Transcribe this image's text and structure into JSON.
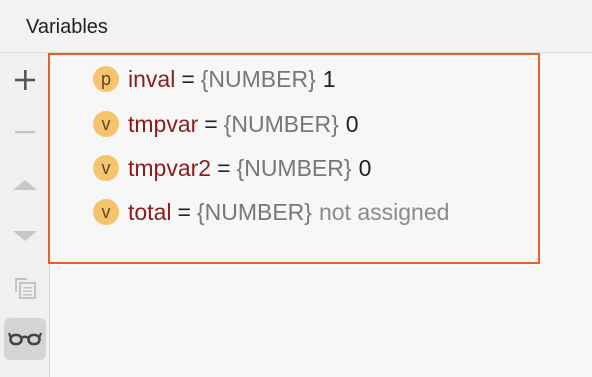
{
  "header": {
    "title": "Variables"
  },
  "toolbar": {
    "buttons": [
      {
        "name": "add",
        "icon": "plus-icon",
        "enabled": true
      },
      {
        "name": "remove",
        "icon": "minus-icon",
        "enabled": false
      },
      {
        "name": "move-up",
        "icon": "arrow-up-icon",
        "enabled": false
      },
      {
        "name": "move-down",
        "icon": "arrow-down-icon",
        "enabled": false
      },
      {
        "name": "copy",
        "icon": "copy-icon",
        "enabled": false
      },
      {
        "name": "watches",
        "icon": "glasses-icon",
        "enabled": true,
        "active": true
      }
    ]
  },
  "variables": [
    {
      "badge": "p",
      "name": "inval",
      "eq": "=",
      "type": "{NUMBER}",
      "value": "1",
      "value_muted": false
    },
    {
      "badge": "v",
      "name": "tmpvar",
      "eq": "=",
      "type": "{NUMBER}",
      "value": "0",
      "value_muted": false
    },
    {
      "badge": "v",
      "name": "tmpvar2",
      "eq": "=",
      "type": "{NUMBER}",
      "value": "0",
      "value_muted": false
    },
    {
      "badge": "v",
      "name": "total",
      "eq": "=",
      "type": "{NUMBER}",
      "value": "not assigned",
      "value_muted": true
    }
  ],
  "colors": {
    "highlight_border": "#e2622a",
    "badge_bg": "#f5c46c",
    "var_name": "#8c1c1c",
    "type_text": "#777777"
  }
}
